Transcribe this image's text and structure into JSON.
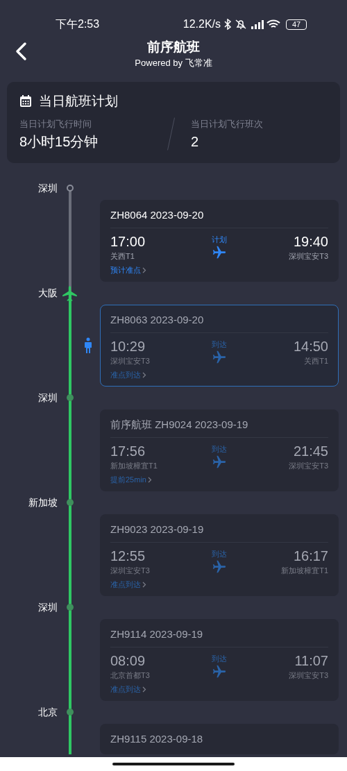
{
  "status_bar": {
    "time": "下午2:53",
    "speed": "12.2K/s",
    "battery": "47"
  },
  "header": {
    "title": "前序航班",
    "subtitle": "Powered by 飞常准"
  },
  "summary": {
    "title": "当日航班计划",
    "stats": [
      {
        "label": "当日计划飞行时间",
        "value": "8小时15分钟"
      },
      {
        "label": "当日计划飞行班次",
        "value": "2"
      }
    ]
  },
  "timeline": [
    {
      "kind": "stop",
      "name": "深圳",
      "current": false,
      "passed": false
    },
    {
      "kind": "flight",
      "title": "ZH8064 2023-09-20",
      "dep_time": "17:00",
      "dep_airport": "关西T1",
      "status": "计划",
      "arr_time": "19:40",
      "arr_airport": "深圳宝安T3",
      "note": "预计准点",
      "past": false,
      "selected": false,
      "traveler": false
    },
    {
      "kind": "stop",
      "name": "大阪",
      "current": true,
      "passed": false
    },
    {
      "kind": "flight",
      "title": "ZH8063 2023-09-20",
      "dep_time": "10:29",
      "dep_airport": "深圳宝安T3",
      "status": "到达",
      "arr_time": "14:50",
      "arr_airport": "关西T1",
      "note": "准点到达",
      "past": true,
      "selected": true,
      "traveler": true
    },
    {
      "kind": "stop",
      "name": "深圳",
      "current": false,
      "passed": true
    },
    {
      "kind": "flight",
      "title": "前序航班 ZH9024 2023-09-19",
      "dep_time": "17:56",
      "dep_airport": "新加坡樟宜T1",
      "status": "到达",
      "arr_time": "21:45",
      "arr_airport": "深圳宝安T3",
      "note": "提前25min",
      "past": true,
      "selected": false,
      "traveler": false
    },
    {
      "kind": "stop",
      "name": "新加坡",
      "current": false,
      "passed": true
    },
    {
      "kind": "flight",
      "title": "ZH9023 2023-09-19",
      "dep_time": "12:55",
      "dep_airport": "深圳宝安T3",
      "status": "到达",
      "arr_time": "16:17",
      "arr_airport": "新加坡樟宜T1",
      "note": "准点到达",
      "past": true,
      "selected": false,
      "traveler": false
    },
    {
      "kind": "stop",
      "name": "深圳",
      "current": false,
      "passed": true
    },
    {
      "kind": "flight",
      "title": "ZH9114 2023-09-19",
      "dep_time": "08:09",
      "dep_airport": "北京首都T3",
      "status": "到达",
      "arr_time": "11:07",
      "arr_airport": "深圳宝安T3",
      "note": "准点到达",
      "past": true,
      "selected": false,
      "traveler": false
    },
    {
      "kind": "stop",
      "name": "北京",
      "current": false,
      "passed": true
    },
    {
      "kind": "flight",
      "title": "ZH9115 2023-09-18",
      "past": true,
      "selected": false,
      "traveler": false
    }
  ]
}
